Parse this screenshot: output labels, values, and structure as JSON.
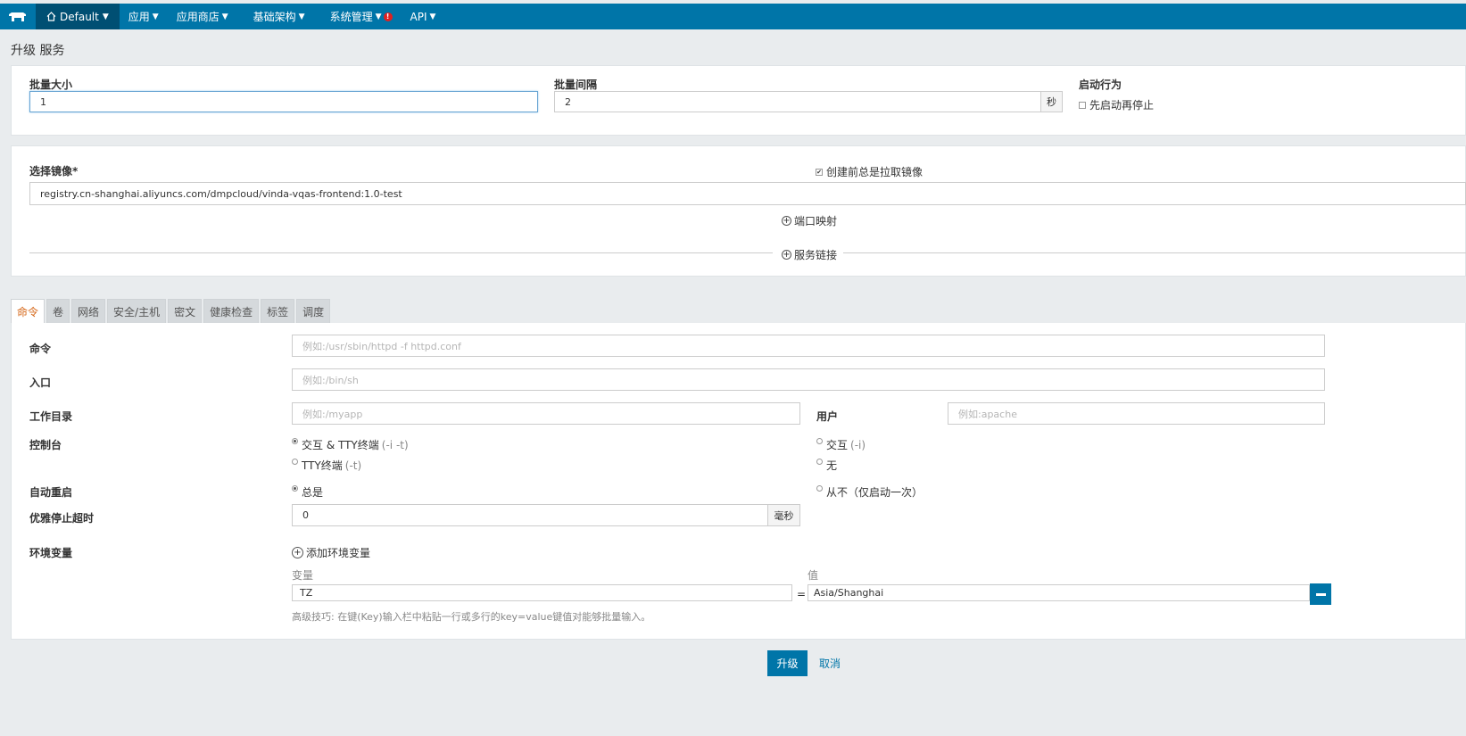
{
  "nav": {
    "env_label": "Default",
    "items": [
      {
        "label": "应用"
      },
      {
        "label": "应用商店"
      },
      {
        "label": "基础架构"
      },
      {
        "label": "系统管理",
        "alert": "!"
      },
      {
        "label": "API"
      }
    ]
  },
  "page_title": "升级 服务",
  "batch": {
    "size_label": "批量大小",
    "size_value": "1",
    "interval_label": "批量间隔",
    "interval_value": "2",
    "interval_unit": "秒",
    "start_label": "启动行为",
    "start_checkbox": "先启动再停止"
  },
  "image": {
    "label": "选择镜像*",
    "value": "registry.cn-shanghai.aliyuncs.com/dmpcloud/vinda-vqas-frontend:1.0-test",
    "pull_checkbox": "创建前总是拉取镜像",
    "port_mapping": "端口映射",
    "service_link": "服务链接"
  },
  "tabs": [
    "命令",
    "卷",
    "网络",
    "安全/主机",
    "密文",
    "健康检查",
    "标签",
    "调度"
  ],
  "command": {
    "cmd_label": "命令",
    "cmd_placeholder": "例如:/usr/sbin/httpd -f httpd.conf",
    "entry_label": "入口",
    "entry_placeholder": "例如:/bin/sh",
    "workdir_label": "工作目录",
    "workdir_placeholder": "例如:/myapp",
    "user_label": "用户",
    "user_placeholder": "例如:apache",
    "console_label": "控制台",
    "console_options": [
      {
        "label": "交互 & TTY终端",
        "hint": "(-i -t)",
        "selected": true
      },
      {
        "label": "交互",
        "hint": "(-i)",
        "selected": false
      },
      {
        "label": "TTY终端",
        "hint": "(-t)",
        "selected": false
      },
      {
        "label": "无",
        "hint": "",
        "selected": false
      }
    ],
    "restart_label": "自动重启",
    "restart_options": [
      {
        "label": "总是",
        "selected": true
      },
      {
        "label": "从不（仅启动一次）",
        "selected": false
      }
    ],
    "stop_timeout_label": "优雅停止超时",
    "stop_timeout_value": "0",
    "stop_timeout_unit": "毫秒",
    "env_label": "环境变量",
    "add_env": "添加环境变量",
    "env_key_header": "变量",
    "env_value_header": "值",
    "env_rows": [
      {
        "key": "TZ",
        "value": "Asia/Shanghai"
      }
    ],
    "tip": "高级技巧: 在键(Key)输入栏中粘贴一行或多行的key=value键值对能够批量输入。"
  },
  "actions": {
    "submit": "升级",
    "cancel": "取消"
  },
  "colors": {
    "nav": "#0075a8",
    "nav_env": "#004f73",
    "active_tab": "#d56516"
  }
}
